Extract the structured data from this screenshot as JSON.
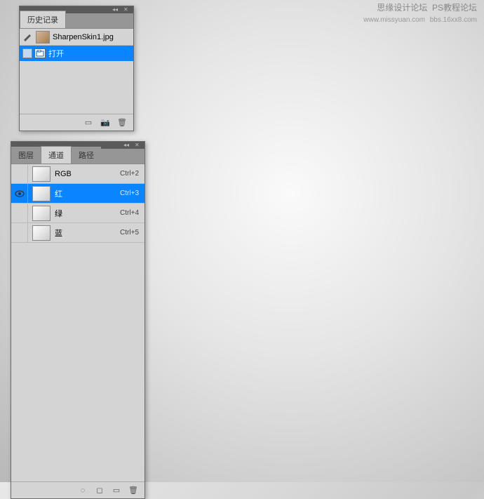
{
  "watermark": {
    "line1": "思缘设计论坛",
    "line2": "PS教程论坛",
    "line3": "www.missyuan.com",
    "line4": "bbs.16xx8.com"
  },
  "history": {
    "title": "历史记录",
    "snapshot_name": "SharpenSkin1.jpg",
    "items": [
      {
        "label": "打开",
        "selected": true
      }
    ]
  },
  "channels": {
    "tabs": {
      "layers": "图层",
      "channels": "通道",
      "paths": "路径"
    },
    "items": [
      {
        "name": "RGB",
        "shortcut": "Ctrl+2",
        "selected": false,
        "visible": false
      },
      {
        "name": "红",
        "shortcut": "Ctrl+3",
        "selected": true,
        "visible": true
      },
      {
        "name": "绿",
        "shortcut": "Ctrl+4",
        "selected": false,
        "visible": false
      },
      {
        "name": "蓝",
        "shortcut": "Ctrl+5",
        "selected": false,
        "visible": false
      }
    ]
  }
}
